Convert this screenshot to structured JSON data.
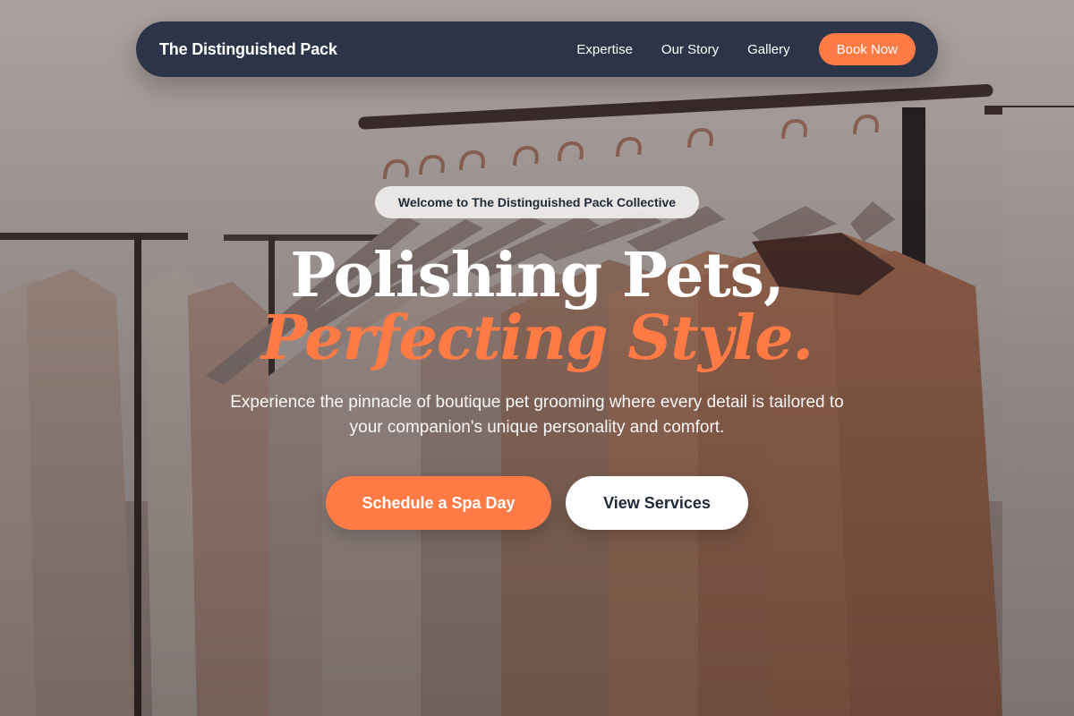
{
  "nav": {
    "brand": "The Distinguished Pack",
    "links": [
      "Expertise",
      "Our Story",
      "Gallery"
    ],
    "cta_label": "Book Now"
  },
  "hero": {
    "badge": "Welcome to The Distinguished Pack Collective",
    "headline_line1": "Polishing Pets,",
    "headline_line2": "Perfecting Style.",
    "subtext": "Experience the pinnacle of boutique pet grooming where every detail is tailored to your companion's unique personality and comfort.",
    "primary_cta": "Schedule a Spa Day",
    "secondary_cta": "View Services"
  },
  "colors": {
    "accent": "#ff7a45",
    "navbar": "#2b3547",
    "text_dark": "#1f2937"
  }
}
